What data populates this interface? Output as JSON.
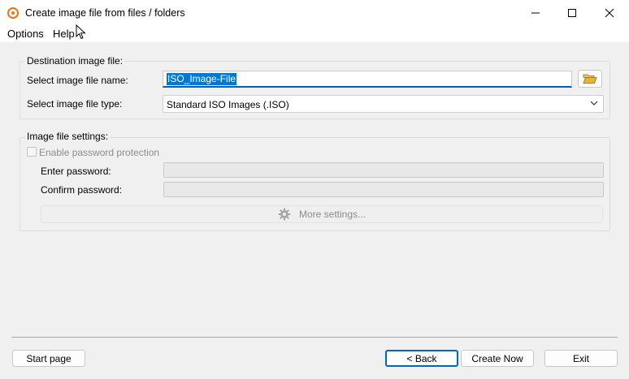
{
  "window": {
    "title": "Create image file from files / folders",
    "icon": "disc-icon"
  },
  "menu": {
    "items": [
      {
        "label": "Options"
      },
      {
        "label": "Help"
      }
    ]
  },
  "destination": {
    "group_title": "Destination image file:",
    "name_label": "Select image file name:",
    "name_value": "ISO_Image-File",
    "type_label": "Select image file type:",
    "type_value": "Standard ISO Images (.ISO)"
  },
  "settings": {
    "group_title": "Image file settings:",
    "password_protection_label": "Enable password protection",
    "password_protection_checked": false,
    "enter_password_label": "Enter password:",
    "confirm_password_label": "Confirm password:",
    "more_settings_label": "More settings..."
  },
  "footer": {
    "start_page": "Start page",
    "back": "< Back",
    "create_now": "Create Now",
    "exit": "Exit"
  },
  "colors": {
    "accent": "#0078d7",
    "icon_orange": "#e07a1e",
    "folder_yellow": "#e8b33a"
  }
}
